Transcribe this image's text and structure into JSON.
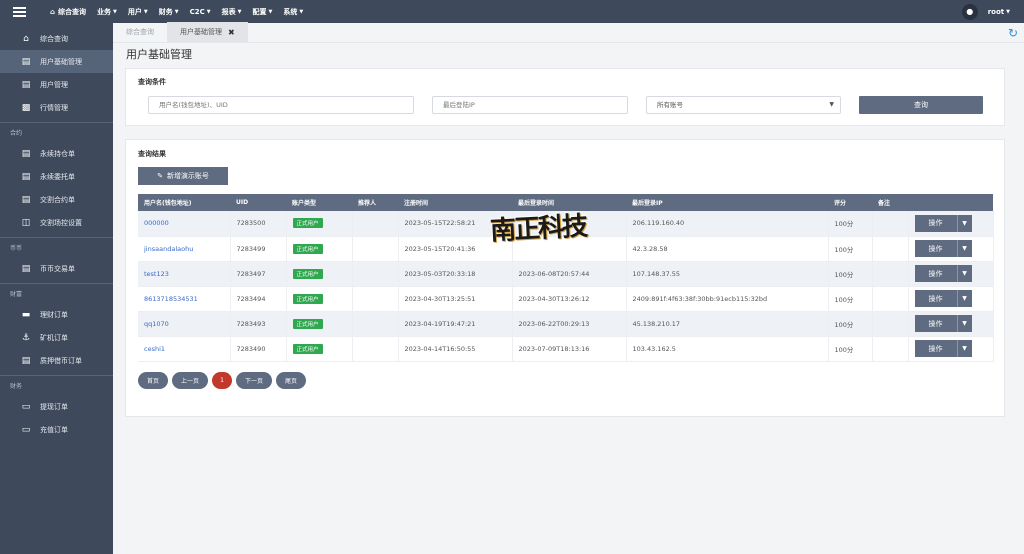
{
  "topnav": {
    "items": [
      {
        "label": "综合查询",
        "has_caret": false
      },
      {
        "label": "业务",
        "has_caret": true
      },
      {
        "label": "用户",
        "has_caret": true
      },
      {
        "label": "财务",
        "has_caret": true
      },
      {
        "label": "C2C",
        "has_caret": true
      },
      {
        "label": "报表",
        "has_caret": true
      },
      {
        "label": "配置",
        "has_caret": true
      },
      {
        "label": "系统",
        "has_caret": true
      }
    ],
    "user": "root"
  },
  "sidebar": {
    "items": [
      {
        "label": "综合查询",
        "icon": "home-icon"
      },
      {
        "label": "用户基础管理",
        "icon": "user-card-icon"
      },
      {
        "label": "用户管理",
        "icon": "document-icon"
      },
      {
        "label": "行情管理",
        "icon": "bar-chart-icon"
      }
    ],
    "group_contract": "合约",
    "contract_items": [
      {
        "label": "永续持仓单",
        "icon": "document-icon"
      },
      {
        "label": "永续委托单",
        "icon": "document-icon"
      },
      {
        "label": "交割合约单",
        "icon": "document-icon"
      },
      {
        "label": "交割场控设置",
        "icon": "columns-icon"
      }
    ],
    "group_coin": "币币",
    "coin_items": [
      {
        "label": "币币交易单",
        "icon": "document-icon"
      }
    ],
    "group_wealth": "财富",
    "wealth_items": [
      {
        "label": "理财订单",
        "icon": "folder-icon"
      },
      {
        "label": "矿机订单",
        "icon": "anchor-icon"
      },
      {
        "label": "质押借币订单",
        "icon": "document-icon"
      }
    ],
    "group_finance": "财务",
    "finance_items": [
      {
        "label": "提现订单",
        "icon": "card-icon"
      },
      {
        "label": "充值订单",
        "icon": "card-icon"
      }
    ]
  },
  "tabs": [
    {
      "label": "综合查询",
      "active": false
    },
    {
      "label": "用户基础管理",
      "active": true
    }
  ],
  "page_title": "用户基础管理",
  "query": {
    "title": "查询条件",
    "username_placeholder": "用户名(钱包地址)、UID",
    "ip_placeholder": "最后登陆IP",
    "account_select": "所有账号",
    "query_button": "查询"
  },
  "results": {
    "title": "查询结果",
    "add_button": "新增演示账号",
    "headers": [
      "用户名(钱包地址)",
      "UID",
      "账户类型",
      "推荐人",
      "注册时间",
      "最后登录时间",
      "最后登录IP",
      "评分",
      "备注",
      ""
    ],
    "rows": [
      {
        "username": "000000",
        "uid": "7283500",
        "type": "正式用户",
        "referrer": "",
        "reg_time": "2023-05-15T22:58:21",
        "last_login": "",
        "ip": "206.119.160.40",
        "score": "100分",
        "note": ""
      },
      {
        "username": "jinsaandalaohu",
        "uid": "7283499",
        "type": "正式用户",
        "referrer": "",
        "reg_time": "2023-05-15T20:41:36",
        "last_login": "",
        "ip": "42.3.28.58",
        "score": "100分",
        "note": ""
      },
      {
        "username": "test123",
        "uid": "7283497",
        "type": "正式用户",
        "referrer": "",
        "reg_time": "2023-05-03T20:33:18",
        "last_login": "2023-06-08T20:57:44",
        "ip": "107.148.37.55",
        "score": "100分",
        "note": ""
      },
      {
        "username": "8613718534531",
        "uid": "7283494",
        "type": "正式用户",
        "referrer": "",
        "reg_time": "2023-04-30T13:25:51",
        "last_login": "2023-04-30T13:26:12",
        "ip": "2409:891f:4f63:38f:30bb:91ecb115:32bd",
        "score": "100分",
        "note": ""
      },
      {
        "username": "qq1070",
        "uid": "7283493",
        "type": "正式用户",
        "referrer": "",
        "reg_time": "2023-04-19T19:47:21",
        "last_login": "2023-06-22T00:29:13",
        "ip": "45.138.210.17",
        "score": "100分",
        "note": ""
      },
      {
        "username": "ceshi1",
        "uid": "7283490",
        "type": "正式用户",
        "referrer": "",
        "reg_time": "2023-04-14T16:50:55",
        "last_login": "2023-07-09T18:13:16",
        "ip": "103.43.162.5",
        "score": "100分",
        "note": ""
      }
    ],
    "action_label": "操作"
  },
  "pager": {
    "first": "首页",
    "prev": "上一页",
    "current": "1",
    "next": "下一页",
    "last": "尾页"
  },
  "watermark": "南正科技",
  "colors": {
    "nav_bg": "#3e4a5c",
    "accent": "#5e6b80",
    "badge_green": "#2fa84f",
    "link_blue": "#3a6ac2",
    "page_red": "#c0392b"
  }
}
